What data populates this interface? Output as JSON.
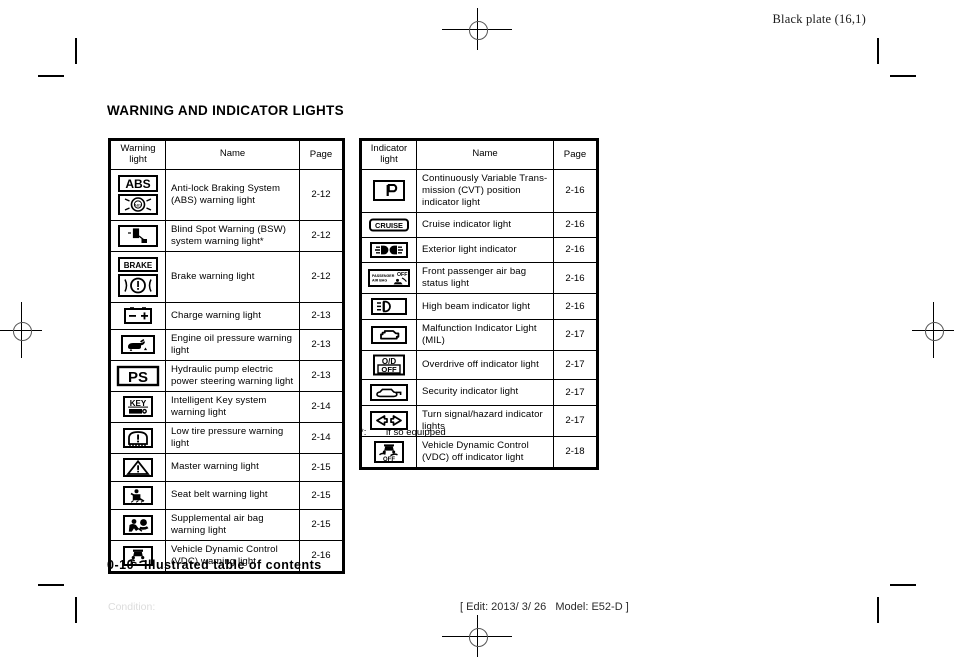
{
  "header": {
    "black_plate": "Black plate (16,1)"
  },
  "section": {
    "title": "WARNING AND INDICATOR LIGHTS"
  },
  "footer": {
    "page_number": "0-10",
    "page_label": "Illustrated table of contents",
    "condition": "Condition:",
    "edit_info": "[ Edit: 2013/ 3/ 26   Model: E52-D ]"
  },
  "warning_table": {
    "headers": {
      "icon": "Warning\nlight",
      "icon_line1": "Warning",
      "icon_line2": "light",
      "name": "Name",
      "page": "Page"
    },
    "rows": [
      {
        "icon": "abs-warning-icon",
        "icon_text": "ABS",
        "name": "Anti-lock Braking System (ABS) warning light",
        "page": "2-12"
      },
      {
        "icon": "bsw-warning-icon",
        "icon_text": "",
        "name": "Blind Spot Warning (BSW) system warning light*",
        "page": "2-12"
      },
      {
        "icon": "brake-warning-icon",
        "icon_text": "BRAKE",
        "name": "Brake warning light",
        "page": "2-12"
      },
      {
        "icon": "charge-warning-icon",
        "icon_text": "",
        "name": "Charge warning light",
        "page": "2-13"
      },
      {
        "icon": "oil-pressure-warning-icon",
        "icon_text": "",
        "name": "Engine oil pressure warning light",
        "page": "2-13"
      },
      {
        "icon": "power-steering-warning-icon",
        "icon_text": "PS",
        "name": "Hydraulic pump electric power steering warning light",
        "page": "2-13"
      },
      {
        "icon": "intelligent-key-warning-icon",
        "icon_text": "KEY",
        "name": "Intelligent Key system warning light",
        "page": "2-14"
      },
      {
        "icon": "low-tire-pressure-warning-icon",
        "icon_text": "",
        "name": "Low tire pressure warning light",
        "page": "2-14"
      },
      {
        "icon": "master-warning-icon",
        "icon_text": "",
        "name": "Master warning light",
        "page": "2-15"
      },
      {
        "icon": "seat-belt-warning-icon",
        "icon_text": "",
        "name": "Seat belt warning light",
        "page": "2-15"
      },
      {
        "icon": "air-bag-warning-icon",
        "icon_text": "",
        "name": "Supplemental air bag warning light",
        "page": "2-15"
      },
      {
        "icon": "vdc-warning-icon",
        "icon_text": "",
        "name": "Vehicle Dynamic Control (VDC) warning light",
        "page": "2-16"
      }
    ]
  },
  "indicator_table": {
    "headers": {
      "icon_line1": "Indicator",
      "icon_line2": "light",
      "name": "Name",
      "page": "Page"
    },
    "rows": [
      {
        "icon": "cvt-position-indicator-icon",
        "icon_text": "P",
        "name": "Continuously Variable Trans-mission (CVT) position indicator light",
        "page": "2-16"
      },
      {
        "icon": "cruise-indicator-icon",
        "icon_text": "CRUISE",
        "name": "Cruise indicator light",
        "page": "2-16"
      },
      {
        "icon": "exterior-light-indicator-icon",
        "icon_text": "",
        "name": "Exterior light indicator",
        "page": "2-16"
      },
      {
        "icon": "passenger-air-bag-status-icon",
        "icon_text": "PASSENGER AIR BAG OFF",
        "name": "Front passenger air bag status light",
        "page": "2-16"
      },
      {
        "icon": "high-beam-indicator-icon",
        "icon_text": "",
        "name": "High beam indicator light",
        "page": "2-16"
      },
      {
        "icon": "malfunction-indicator-icon",
        "icon_text": "",
        "name": "Malfunction Indicator Light (MIL)",
        "page": "2-17"
      },
      {
        "icon": "overdrive-off-indicator-icon",
        "icon_text": "O/D OFF",
        "name": "Overdrive off indicator light",
        "page": "2-17"
      },
      {
        "icon": "security-indicator-icon",
        "icon_text": "",
        "name": "Security indicator light",
        "page": "2-17"
      },
      {
        "icon": "turn-signal-indicator-icon",
        "icon_text": "",
        "name": "Turn signal/hazard indicator lights",
        "page": "2-17"
      },
      {
        "icon": "vdc-off-indicator-icon",
        "icon_text": "OFF",
        "name": "Vehicle Dynamic Control (VDC) off indicator light",
        "page": "2-18"
      }
    ]
  },
  "footnote": {
    "marker": "*:",
    "text": "if so equipped"
  }
}
